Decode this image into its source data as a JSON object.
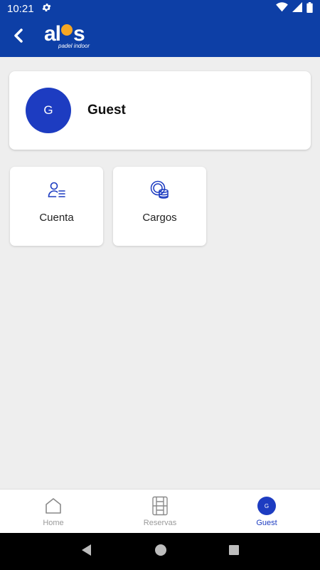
{
  "status_bar": {
    "time": "10:21"
  },
  "app_bar": {
    "logo_text_left": "al",
    "logo_text_right": "s",
    "logo_sub": "padel indoor"
  },
  "profile": {
    "initial": "G",
    "name": "Guest"
  },
  "tiles": [
    {
      "label": "Cuenta",
      "icon": "user-list-icon"
    },
    {
      "label": "Cargos",
      "icon": "coins-icon"
    }
  ],
  "bottom_nav": {
    "items": [
      {
        "label": "Home",
        "icon": "home-icon"
      },
      {
        "label": "Reservas",
        "icon": "court-icon"
      },
      {
        "label": "Guest",
        "icon": "avatar",
        "initial": "G"
      }
    ]
  },
  "colors": {
    "primary": "#0d3fa6",
    "avatar": "#1d3cc1",
    "accent": "#f5a623",
    "background": "#eeeeee"
  }
}
